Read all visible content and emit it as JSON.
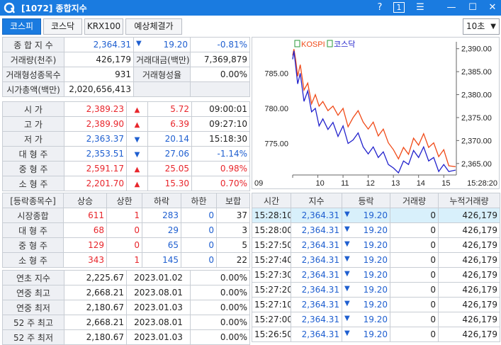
{
  "window": {
    "code_title": "[1072] 종합지수",
    "help": "?",
    "page": "1",
    "menu": "☰",
    "minimize": "—",
    "maximize": "☐",
    "close": "✕"
  },
  "tabs": [
    {
      "label": "코스피",
      "active": true
    },
    {
      "label": "코스닥",
      "active": false
    },
    {
      "label": "KRX100",
      "active": false
    },
    {
      "label": "예상체결가",
      "active": false
    }
  ],
  "interval": "10초",
  "summary": {
    "index_label": "종 합 지 수",
    "index_value": "2,364.31",
    "index_change": "19.20",
    "index_change_pct": "-0.81%",
    "volume_label": "거래량(천주)",
    "volume_value": "426,179",
    "amount_label": "거래대금(백만)",
    "amount_value": "7,369,879",
    "formed_count_label": "거래형성종목수",
    "formed_count_value": "931",
    "formed_rate_label": "거래형성율",
    "formed_rate_value": "0.00%",
    "mktcap_label": "시가총액(백만)",
    "mktcap_value": "2,020,656,413"
  },
  "prices": [
    {
      "label": "시 가",
      "value": "2,389.23",
      "dir": "up",
      "change": "5.72",
      "extra": "09:00:01",
      "extra_color": "dk"
    },
    {
      "label": "고 가",
      "value": "2,389.90",
      "dir": "up",
      "change": "6.39",
      "extra": "09:27:10",
      "extra_color": "dk"
    },
    {
      "label": "저 가",
      "value": "2,363.37",
      "dir": "down",
      "change": "20.14",
      "extra": "15:18:30",
      "extra_color": "dk"
    },
    {
      "label": "대 형 주",
      "value": "2,353.51",
      "dir": "down",
      "change": "27.06",
      "extra": "-1.14%",
      "extra_color": "blue"
    },
    {
      "label": "중 형 주",
      "value": "2,591.17",
      "dir": "up",
      "change": "25.05",
      "extra": "0.98%",
      "extra_color": "red"
    },
    {
      "label": "소 형 주",
      "value": "2,201.70",
      "dir": "up",
      "change": "15.30",
      "extra": "0.70%",
      "extra_color": "red"
    }
  ],
  "breadth": {
    "headers": [
      "[등락종목수]",
      "상승",
      "상한",
      "하락",
      "하한",
      "보합"
    ],
    "rows": [
      {
        "label": "시장종합",
        "up": "611",
        "upper": "1",
        "down": "283",
        "lower": "0",
        "flat": "37"
      },
      {
        "label": "대 형 주",
        "up": "68",
        "upper": "0",
        "down": "29",
        "lower": "0",
        "flat": "3"
      },
      {
        "label": "중 형 주",
        "up": "129",
        "upper": "0",
        "down": "65",
        "lower": "0",
        "flat": "5"
      },
      {
        "label": "소 형 주",
        "up": "343",
        "upper": "1",
        "down": "145",
        "lower": "0",
        "flat": "22"
      }
    ]
  },
  "yearly": [
    {
      "label": "연초 지수",
      "value": "2,225.67",
      "date": "2023.01.02",
      "pct": "0.00%"
    },
    {
      "label": "연중 최고",
      "value": "2,668.21",
      "date": "2023.08.01",
      "pct": "0.00%"
    },
    {
      "label": "연중 최저",
      "value": "2,180.67",
      "date": "2023.01.03",
      "pct": "0.00%"
    },
    {
      "label": "52 주 최고",
      "value": "2,668.21",
      "date": "2023.08.01",
      "pct": "0.00%"
    },
    {
      "label": "52 주 최저",
      "value": "2,180.67",
      "date": "2023.01.03",
      "pct": "0.00%"
    }
  ],
  "ticks": {
    "headers": [
      "시간",
      "지수",
      "등락",
      "거래량",
      "누적거래량"
    ],
    "rows": [
      {
        "time": "15:28:10",
        "index": "2,364.31",
        "change": "19.20",
        "vol": "0",
        "cum": "426,179"
      },
      {
        "time": "15:28:00",
        "index": "2,364.31",
        "change": "19.20",
        "vol": "0",
        "cum": "426,179"
      },
      {
        "time": "15:27:50",
        "index": "2,364.31",
        "change": "19.20",
        "vol": "0",
        "cum": "426,179"
      },
      {
        "time": "15:27:40",
        "index": "2,364.31",
        "change": "19.20",
        "vol": "0",
        "cum": "426,179"
      },
      {
        "time": "15:27:30",
        "index": "2,364.31",
        "change": "19.20",
        "vol": "0",
        "cum": "426,179"
      },
      {
        "time": "15:27:20",
        "index": "2,364.31",
        "change": "19.20",
        "vol": "0",
        "cum": "426,179"
      },
      {
        "time": "15:27:10",
        "index": "2,364.31",
        "change": "19.20",
        "vol": "0",
        "cum": "426,179"
      },
      {
        "time": "15:27:00",
        "index": "2,364.31",
        "change": "19.20",
        "vol": "0",
        "cum": "426,179"
      },
      {
        "time": "15:26:50",
        "index": "2,364.31",
        "change": "19.20",
        "vol": "0",
        "cum": "426,179"
      }
    ]
  },
  "colors": {
    "accent": "#1a7be0",
    "up": "#e8262c",
    "down": "#1f5fd0",
    "kospi_line": "#f04a18",
    "kosdaq_line": "#2222cc"
  },
  "chart_data": {
    "type": "line",
    "legend": [
      "KOSPI",
      "코스닥"
    ],
    "legend_placement": "top-left",
    "x_ticks": [
      "09",
      "10",
      "11",
      "12",
      "13",
      "14",
      "15",
      "15:28:20"
    ],
    "left_axis": {
      "ticks": [
        "785.00",
        "780.00",
        "775.00"
      ],
      "range": [
        770.5,
        789.5
      ]
    },
    "right_axis": {
      "ticks": [
        "2,390.00",
        "2,385.00",
        "2,380.00",
        "2,375.00",
        "2,370.00",
        "2,365.00"
      ],
      "range": [
        2362.5,
        2391.5
      ]
    },
    "series": [
      {
        "name": "KOSPI",
        "axis": "right",
        "x": [
          9.0,
          9.05,
          9.12,
          9.2,
          9.3,
          9.45,
          9.6,
          9.75,
          9.9,
          10.05,
          10.2,
          10.4,
          10.6,
          10.8,
          11.0,
          11.2,
          11.4,
          11.6,
          11.8,
          12.0,
          12.2,
          12.4,
          12.6,
          12.8,
          13.0,
          13.2,
          13.4,
          13.6,
          13.8,
          14.0,
          14.2,
          14.4,
          14.6,
          14.8,
          15.0,
          15.2,
          15.47
        ],
        "y": [
          2388.5,
          2389.9,
          2387.5,
          2384.0,
          2386.5,
          2381.0,
          2382.5,
          2378.0,
          2380.0,
          2377.5,
          2378.5,
          2376.5,
          2377.5,
          2375.5,
          2377.0,
          2373.0,
          2375.0,
          2376.5,
          2374.0,
          2372.5,
          2374.0,
          2371.0,
          2372.5,
          2369.5,
          2368.0,
          2366.0,
          2368.5,
          2367.0,
          2370.5,
          2369.0,
          2371.5,
          2368.5,
          2369.5,
          2366.5,
          2368.0,
          2364.5,
          2364.3
        ]
      },
      {
        "name": "코스닥",
        "axis": "left",
        "x": [
          9.0,
          9.05,
          9.12,
          9.2,
          9.3,
          9.45,
          9.6,
          9.75,
          9.9,
          10.05,
          10.2,
          10.4,
          10.6,
          10.8,
          11.0,
          11.2,
          11.4,
          11.6,
          11.8,
          12.0,
          12.2,
          12.4,
          12.6,
          12.8,
          13.0,
          13.2,
          13.4,
          13.6,
          13.8,
          14.0,
          14.2,
          14.4,
          14.6,
          14.8,
          15.0,
          15.2,
          15.47
        ],
        "y": [
          787.0,
          788.2,
          786.0,
          783.5,
          785.0,
          781.0,
          782.5,
          779.5,
          780.0,
          777.5,
          778.5,
          777.0,
          778.0,
          776.0,
          777.5,
          775.0,
          775.5,
          776.5,
          774.5,
          773.5,
          774.5,
          773.0,
          773.8,
          772.0,
          771.5,
          770.8,
          772.5,
          772.0,
          774.0,
          773.0,
          774.5,
          772.5,
          773.0,
          771.0,
          772.0,
          771.0,
          771.2
        ]
      }
    ]
  }
}
